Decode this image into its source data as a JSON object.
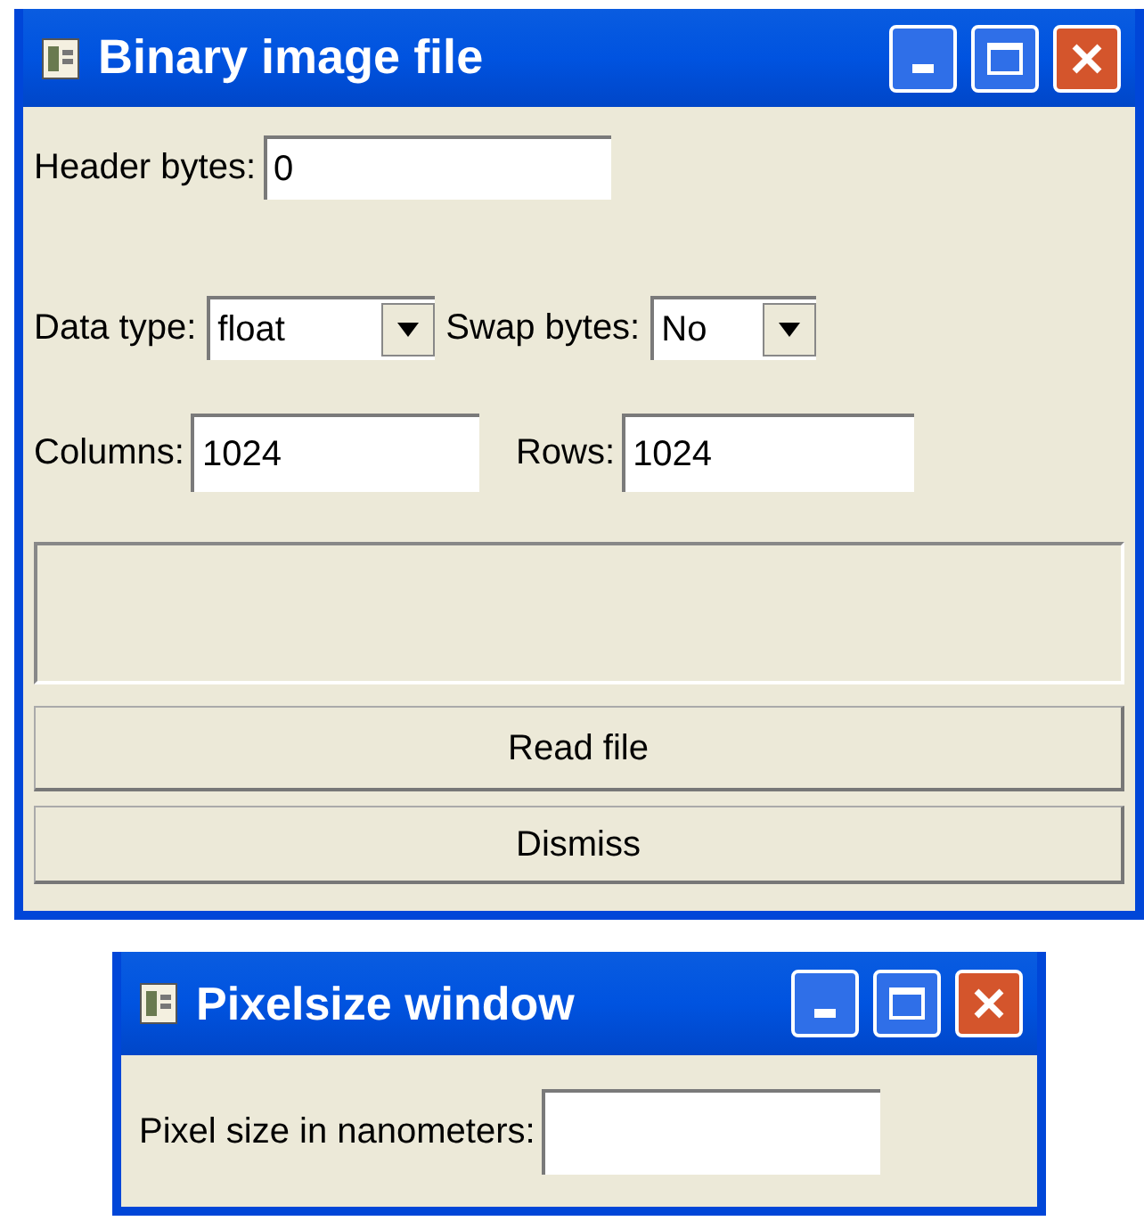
{
  "windows": [
    {
      "title": "Binary image file",
      "header_bytes": {
        "label": "Header bytes:",
        "value": "0"
      },
      "data_type": {
        "label": "Data type:",
        "value": "float"
      },
      "swap_bytes": {
        "label": "Swap bytes:",
        "value": "No"
      },
      "columns": {
        "label": "Columns:",
        "value": "1024"
      },
      "rows": {
        "label": "Rows:",
        "value": "1024"
      },
      "buttons": [
        "Read file",
        "Dismiss"
      ]
    },
    {
      "title": "Pixelsize window",
      "pixel_size": {
        "label": "Pixel size in nanometers:"
      }
    }
  ]
}
